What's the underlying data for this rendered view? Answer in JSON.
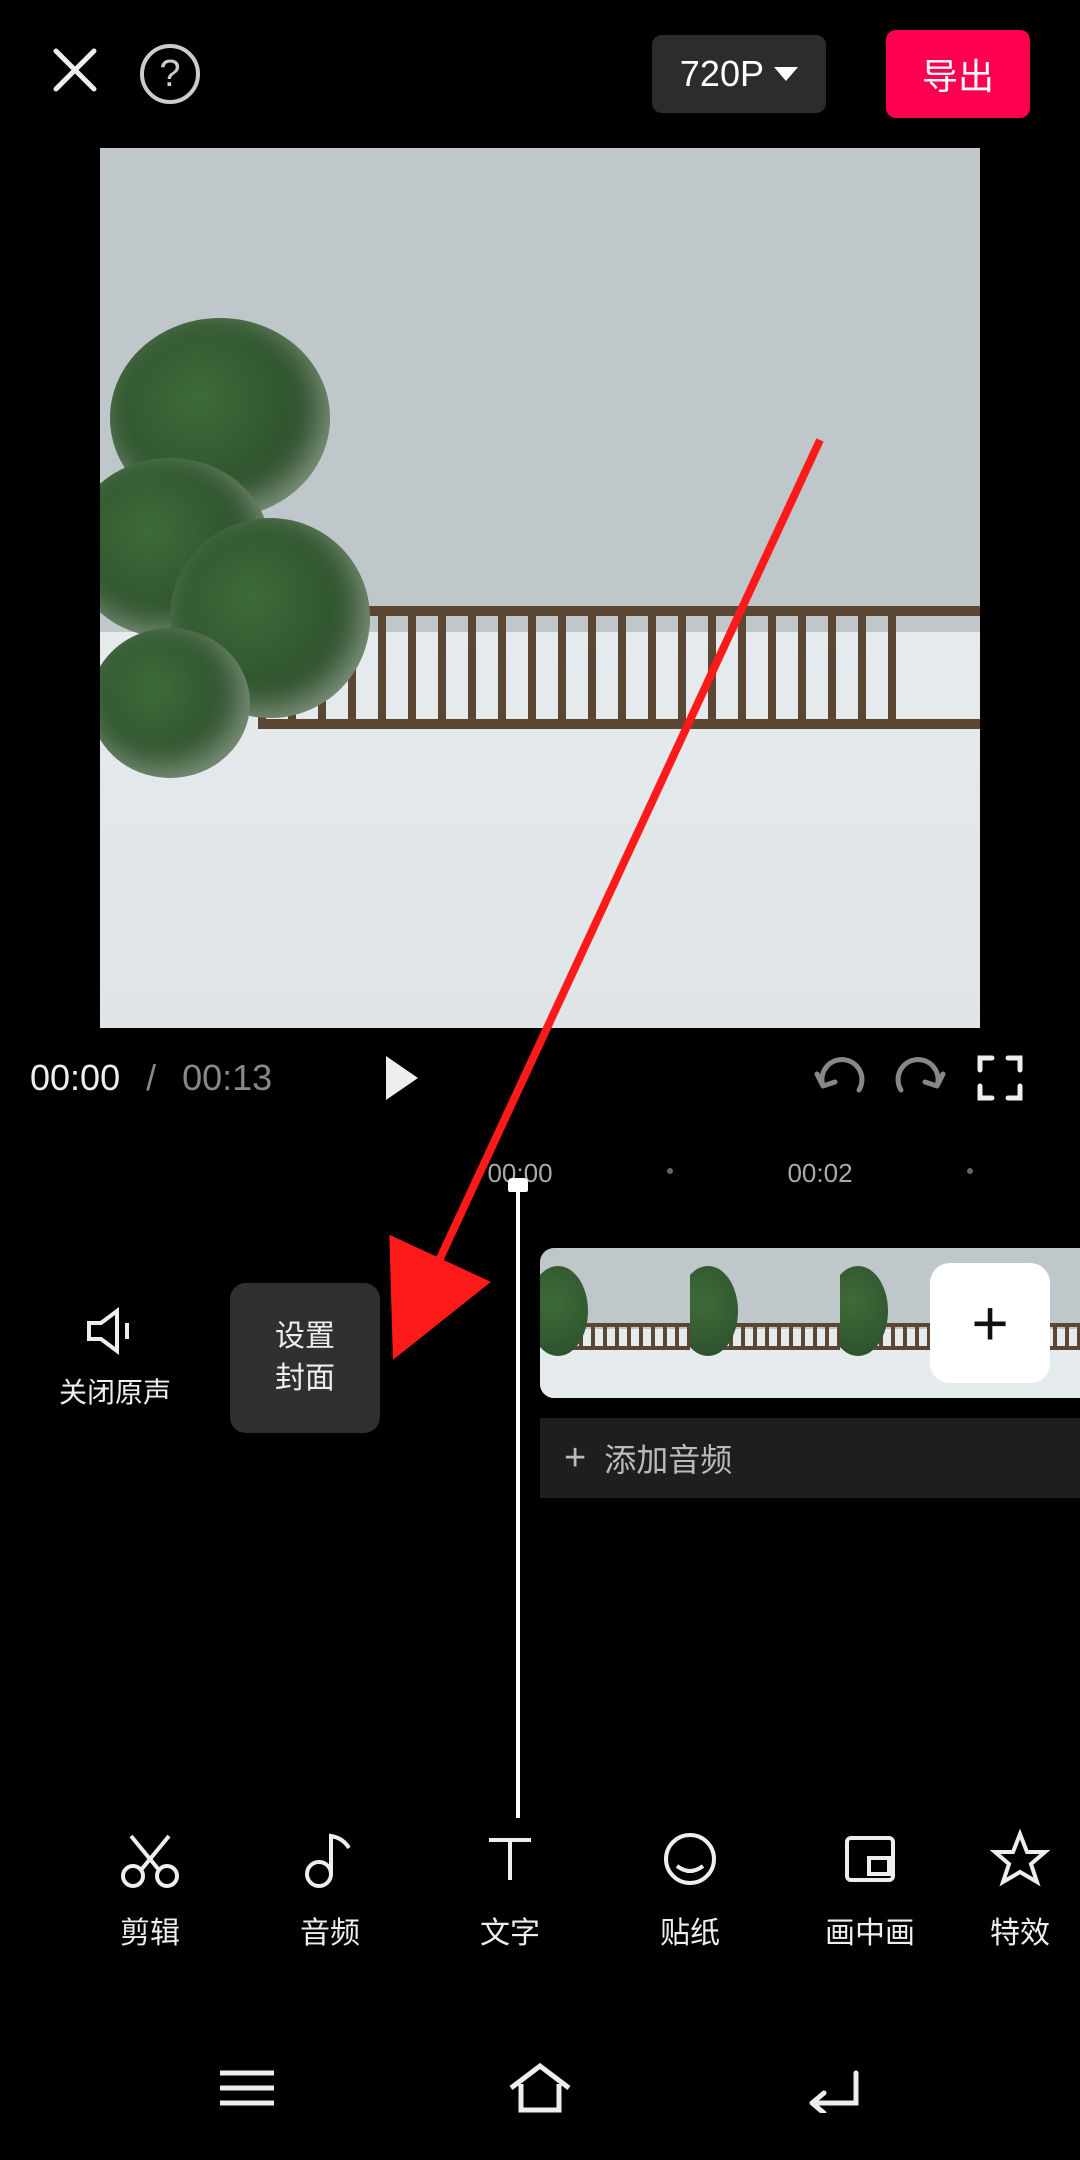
{
  "topbar": {
    "resolution_label": "720P",
    "export_label": "导出"
  },
  "playback": {
    "current_time": "00:00",
    "separator": "/",
    "total_time": "00:13"
  },
  "ruler": {
    "marks": [
      "00:00",
      "00:02"
    ]
  },
  "timeline": {
    "mute_label": "关闭原声",
    "cover_line1": "设置",
    "cover_line2": "封面",
    "add_clip_label": "+",
    "add_audio_plus": "+",
    "add_audio_label": "添加音频"
  },
  "tools": [
    {
      "id": "edit",
      "label": "剪辑"
    },
    {
      "id": "audio",
      "label": "音频"
    },
    {
      "id": "text",
      "label": "文字"
    },
    {
      "id": "sticker",
      "label": "贴纸"
    },
    {
      "id": "pip",
      "label": "画中画"
    },
    {
      "id": "effect",
      "label": "特效"
    }
  ],
  "colors": {
    "accent": "#ff0050"
  }
}
